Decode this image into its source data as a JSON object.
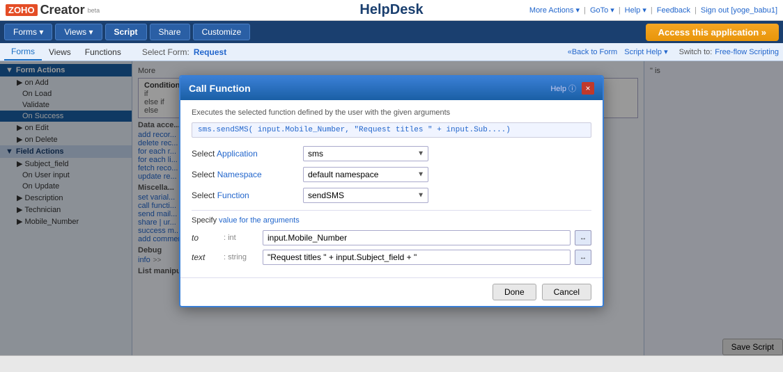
{
  "topBar": {
    "logoText": "Creator",
    "betaLabel": "beta",
    "appTitle": "HelpDesk",
    "topLinks": {
      "moreActions": "More Actions ▾",
      "goTo": "GoTo ▾",
      "help": "Help ▾",
      "feedback": "Feedback",
      "signOut": "Sign out [yoge_babu1]"
    }
  },
  "navBar": {
    "forms": "Forms ▾",
    "views": "Views ▾",
    "script": "Script",
    "share": "Share",
    "customize": "Customize",
    "accessBtn": "Access this application »"
  },
  "subNav": {
    "forms": "Forms",
    "views": "Views",
    "functions": "Functions",
    "selectForm": "Select Form:",
    "formName": "Request",
    "backToForm": "«Back to Form",
    "scriptHelp": "Script Help ▾",
    "switchTo": "Switch to:",
    "freeFlowScripting": "Free-flow Scripting"
  },
  "leftPanel": {
    "formActions": "Form Actions",
    "onAdd": "on Add",
    "onLoad": "On Load",
    "validate": "Validate",
    "onSuccess": "On Success",
    "onEdit": "on Edit",
    "onDelete": "on Delete",
    "fieldActions": "Field Actions",
    "subjectField": "Subject_field",
    "onUserInput": "On User input",
    "onUpdate": "On Update",
    "description": "Description",
    "technician": "Technician",
    "mobileNumber": "Mobile_Number"
  },
  "middlePanel": {
    "moreLabel": "More",
    "conditionLabel": "Condition",
    "conditionText1": "if",
    "conditionText2": "else if",
    "conditionText3": "else",
    "dataAccessLabel": "Data acce...",
    "addRecord": "add recor...",
    "deleteRecord": "delete rec...",
    "forEach1": "for each r...",
    "forEach2": "for each li...",
    "fetchRecord": "fetch reco...",
    "updateRecord": "update re...",
    "miscLabel": "Miscella...",
    "setVariable": "set varial...",
    "callFunction": "call functi...",
    "sendMail": "send mail...",
    "shareUrl": "share | ur...",
    "successMessage": "success m...",
    "addComment": "add comment",
    "debugLabel": "Debug",
    "infoLabel": "info",
    "listManipulation": "List manipulation"
  },
  "rightPanel": {
    "isLabel": "\" is"
  },
  "modal": {
    "title": "Call Function",
    "helpLabel": "Help ⓘ",
    "closeBtn": "×",
    "description": "Executes the selected function defined by the user with the given arguments",
    "codePreview": "sms.sendSMS( input.Mobile_Number, \"Request titles \" + input.Sub....)",
    "selectApplicationLabel": "Select Application",
    "selectNamespaceLabel": "Select Namespace",
    "selectFunctionLabel": "Select Function",
    "applicationValue": "sms",
    "namespaceValue": "default namespace",
    "functionValue": "sendSMS",
    "specifyLabel": "Specify value for the arguments",
    "arg1Name": "to",
    "arg1Type": ": int",
    "arg1Value": "input.Mobile_Number",
    "arg2Name": "text",
    "arg2Type": ": string",
    "arg2Value": "\"Request titles \" + input.Subject_field + \"",
    "doneBtn": "Done",
    "cancelBtn": "Cancel"
  },
  "bottomBar": {
    "saveScriptBtn": "Save Script"
  }
}
